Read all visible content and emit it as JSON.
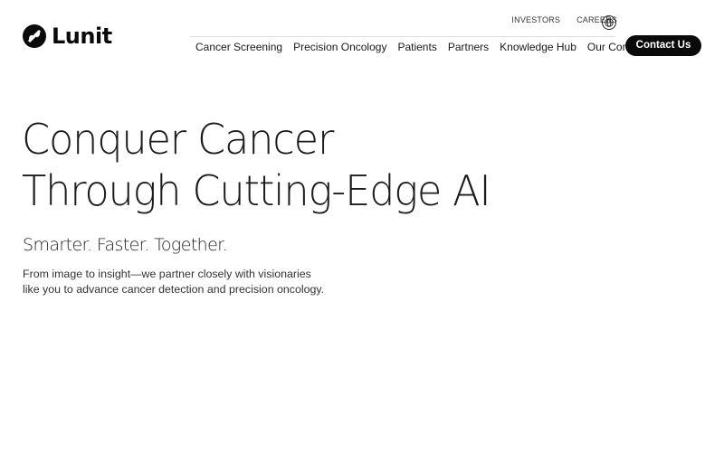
{
  "brand": {
    "name": "Lunit"
  },
  "utility_nav": {
    "items": [
      {
        "label": "INVESTORS"
      },
      {
        "label": "CAREERS"
      }
    ],
    "language_icon": "globe-icon"
  },
  "main_nav": {
    "items": [
      {
        "label": "Cancer Screening"
      },
      {
        "label": "Precision Oncology"
      },
      {
        "label": "Patients"
      },
      {
        "label": "Partners"
      },
      {
        "label": "Knowledge Hub"
      },
      {
        "label": "Our Company"
      }
    ]
  },
  "contact_button": {
    "label": "Contact Us"
  },
  "hero": {
    "title_lines": [
      "Conquer Cancer",
      "Through Cutting-Edge AI"
    ],
    "tagline": "Smarter. Faster. Together.",
    "description_lines": [
      "From image to insight—we partner closely with visionaries",
      "like you to advance cancer detection and precision oncology."
    ]
  },
  "colors": {
    "primary": "#0a0a0a",
    "background": "#ffffff",
    "button_text": "#ffffff"
  }
}
